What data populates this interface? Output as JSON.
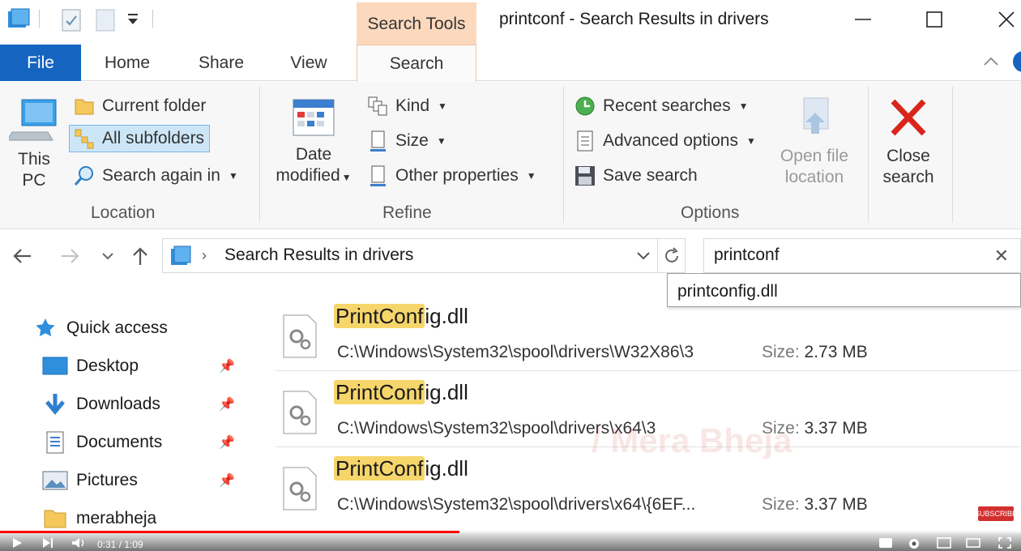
{
  "window": {
    "title": "printconf - Search Results in drivers",
    "contextual_tab": "Search Tools",
    "minimize": "—",
    "maximize": "☐",
    "close": "✕"
  },
  "ribbon_tabs": {
    "file": "File",
    "home": "Home",
    "share": "Share",
    "view": "View",
    "search": "Search"
  },
  "ribbon": {
    "location": {
      "label": "Location",
      "this_pc_line1": "This",
      "this_pc_line2": "PC",
      "current_folder": "Current folder",
      "all_subfolders": "All subfolders",
      "search_again_in": "Search again in"
    },
    "refine": {
      "label": "Refine",
      "date_modified_line1": "Date",
      "date_modified_line2": "modified",
      "kind": "Kind",
      "size": "Size",
      "other_properties": "Other properties"
    },
    "options": {
      "label": "Options",
      "recent_searches": "Recent searches",
      "advanced_options": "Advanced options",
      "save_search": "Save search",
      "open_file_location_line1": "Open file",
      "open_file_location_line2": "location",
      "close_search_line1": "Close",
      "close_search_line2": "search"
    }
  },
  "address": {
    "crumb": "Search Results in drivers"
  },
  "search": {
    "value": "printconf",
    "suggestion": "printconfig.dll"
  },
  "nav_pane": {
    "quick_access": "Quick access",
    "items": [
      {
        "label": "Desktop",
        "pinned": true
      },
      {
        "label": "Downloads",
        "pinned": true
      },
      {
        "label": "Documents",
        "pinned": true
      },
      {
        "label": "Pictures",
        "pinned": true
      },
      {
        "label": "merabheja",
        "pinned": false
      }
    ]
  },
  "results": [
    {
      "name_highlight": "PrintConf",
      "name_rest": "ig.dll",
      "path": "C:\\Windows\\System32\\spool\\drivers\\W32X86\\3",
      "size_label": "Size:",
      "size": "2.73 MB"
    },
    {
      "name_highlight": "PrintConf",
      "name_rest": "ig.dll",
      "path": "C:\\Windows\\System32\\spool\\drivers\\x64\\3",
      "size_label": "Size:",
      "size": "3.37 MB"
    },
    {
      "name_highlight": "PrintConf",
      "name_rest": "ig.dll",
      "path": "C:\\Windows\\System32\\spool\\drivers\\x64\\{6EF...",
      "size_label": "Size:",
      "size": "3.37 MB"
    }
  ],
  "overlay": {
    "watermark": "/ Mera Bheja",
    "subscribe": "SUBSCRIBE"
  },
  "video": {
    "time": "0:31 / 1:09",
    "progress": 0.45
  },
  "colors": {
    "file_tab": "#1565c0",
    "search_tools": "#fcd9bd",
    "highlight": "#f6d56a",
    "selected": "#cde6f7"
  }
}
